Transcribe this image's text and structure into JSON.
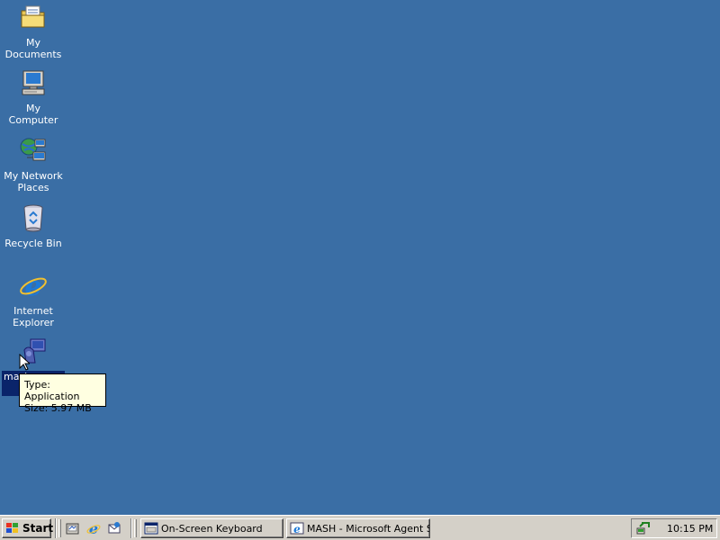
{
  "desktop": {
    "background": "#3a6ea5",
    "icons": [
      {
        "label": "My Documents",
        "icon": "folder-documents-icon"
      },
      {
        "label": "My Computer",
        "icon": "computer-icon"
      },
      {
        "label": "My Network Places",
        "icon": "network-icon"
      },
      {
        "label": "Recycle Bin",
        "icon": "recycle-bin-icon"
      },
      {
        "label": "Internet Explorer",
        "icon": "internet-explorer-icon"
      },
      {
        "label": "mash",
        "icon": "application-icon",
        "selected": true
      }
    ]
  },
  "tooltip": {
    "line1": "Type: Application",
    "line2": "Size: 5.97 MB"
  },
  "taskbar": {
    "start_label": "Start",
    "quick_launch": [
      "show-desktop-icon",
      "internet-explorer-icon",
      "outlook-express-icon"
    ],
    "tasks": [
      {
        "label": "On-Screen Keyboard",
        "icon": "window-icon"
      },
      {
        "label": "MASH - Microsoft Agent S...",
        "icon": "ie-window-icon"
      }
    ],
    "clock": "10:15 PM"
  }
}
